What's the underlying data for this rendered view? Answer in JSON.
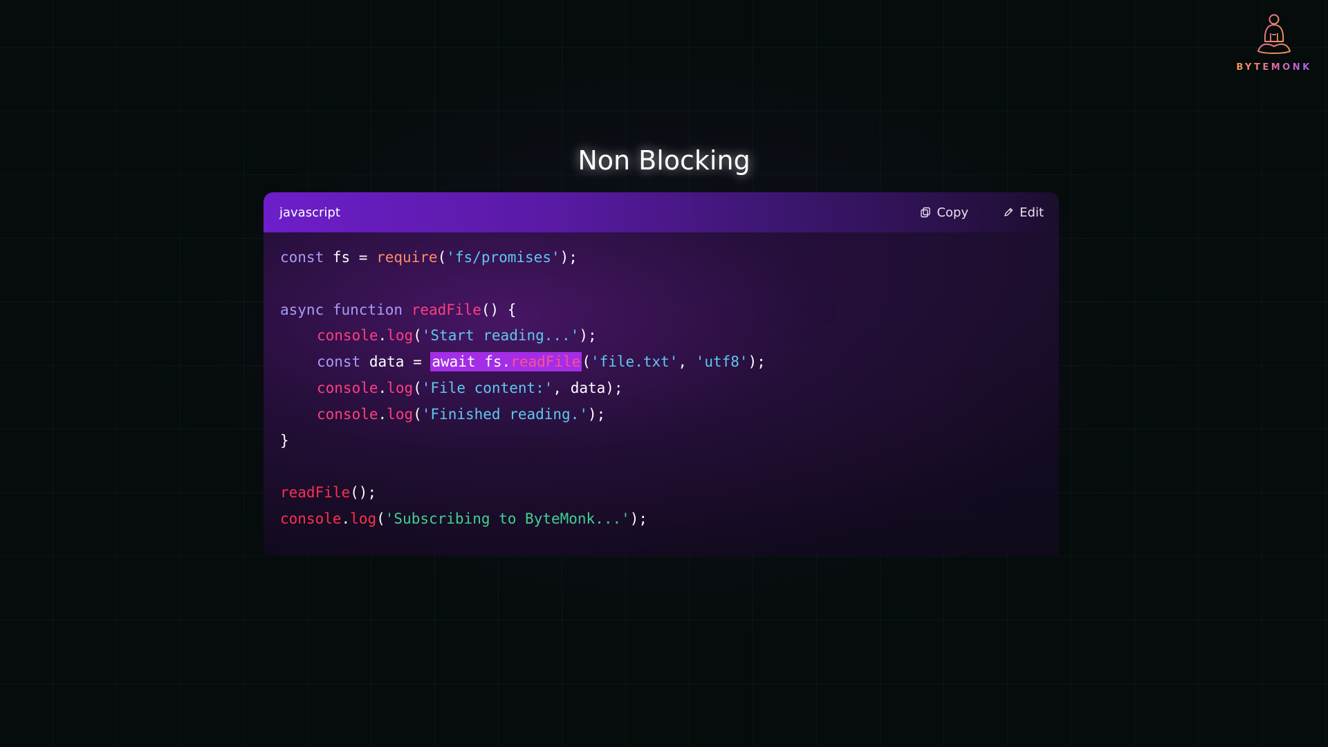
{
  "logo": {
    "text": "BYTEMONK",
    "icon": "meditating-monk-icon",
    "gradient": [
      "#f19a4a",
      "#e36c9a",
      "#a75df0"
    ]
  },
  "title": "Non Blocking",
  "code_block": {
    "language": "javascript",
    "copy_label": "Copy",
    "edit_label": "Edit",
    "copy_icon": "copy-icon",
    "edit_icon": "pencil-icon",
    "header_color": "#6d1ec9",
    "highlight_color": "#a32ee6",
    "lines": {
      "l1": {
        "t1": "const",
        "t2": " fs = ",
        "t3": "require",
        "t4": "(",
        "t5": "'fs/promises'",
        "t6": ");"
      },
      "l3": {
        "t1": "async",
        "t2": " ",
        "t3": "function",
        "t4": " ",
        "t5": "readFile",
        "t6": "() {"
      },
      "l4": {
        "t1": "console",
        "t2": ".",
        "t3": "log",
        "t4": "(",
        "t5": "'Start reading...'",
        "t6": ");"
      },
      "l5": {
        "t1": "const",
        "t2": " data = ",
        "h1": "await",
        "h2": " fs.",
        "h3": "readFile",
        "t3": "(",
        "t4": "'file.txt'",
        "t5": ", ",
        "t6": "'utf8'",
        "t7": ");"
      },
      "l6": {
        "t1": "console",
        "t2": ".",
        "t3": "log",
        "t4": "(",
        "t5": "'File content:'",
        "t6": ", data);"
      },
      "l7": {
        "t1": "console",
        "t2": ".",
        "t3": "log",
        "t4": "(",
        "t5": "'Finished reading.'",
        "t6": ");"
      },
      "l8": {
        "t1": "}"
      },
      "l10": {
        "t1": "readFile",
        "t2": "();"
      },
      "l11": {
        "t1": "console",
        "t2": ".",
        "t3": "log",
        "t4": "(",
        "t5": "'Subscribing to ByteMonk...'",
        "t6": ");"
      }
    }
  }
}
